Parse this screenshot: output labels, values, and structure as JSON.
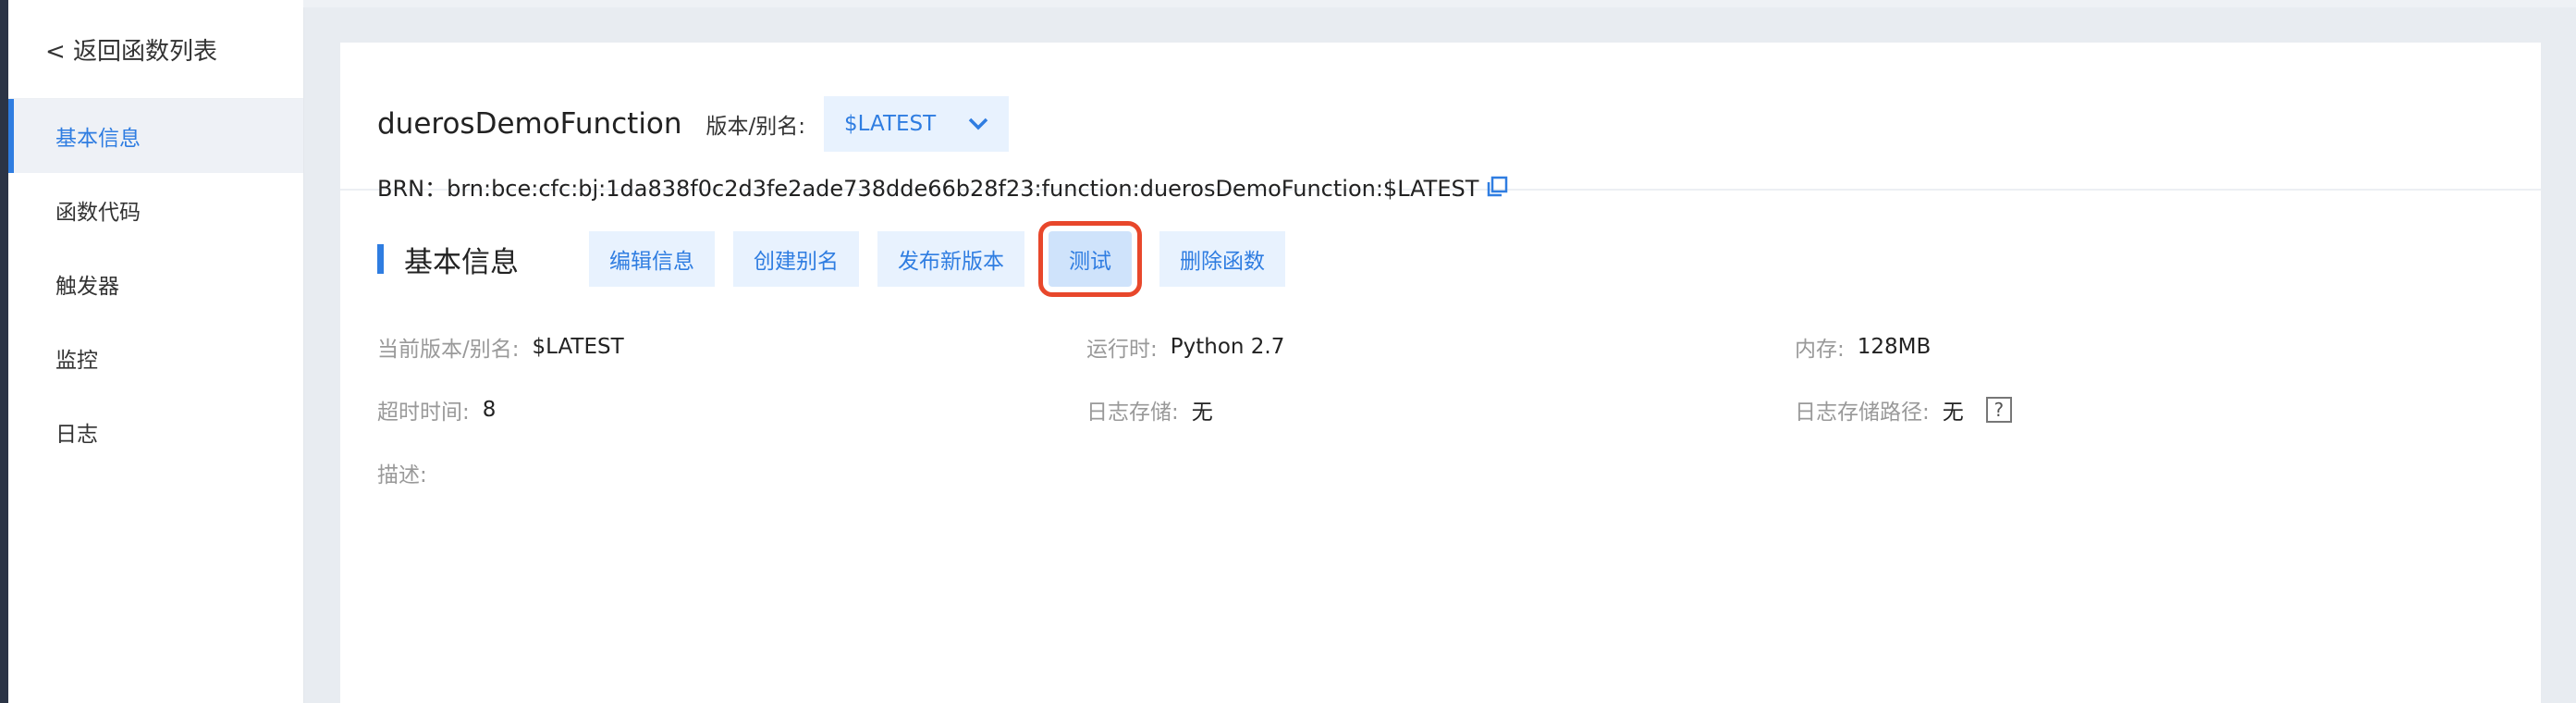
{
  "sidebar": {
    "back": "< 返回函数列表",
    "items": [
      {
        "label": "基本信息"
      },
      {
        "label": "函数代码"
      },
      {
        "label": "触发器"
      },
      {
        "label": "监控"
      },
      {
        "label": "日志"
      }
    ]
  },
  "header": {
    "function_name": "duerosDemoFunction",
    "version_label": "版本/别名:",
    "version_value": "$LATEST",
    "brn": "BRN：brn:bce:cfc:bj:1da838f0c2d3fe2ade738dde66b28f23:function:duerosDemoFunction:$LATEST"
  },
  "section": {
    "title": "基本信息",
    "buttons": [
      "编辑信息",
      "创建别名",
      "发布新版本",
      "测试",
      "删除函数"
    ]
  },
  "props": {
    "current_version": {
      "key": "当前版本/别名:",
      "value": "$LATEST"
    },
    "runtime": {
      "key": "运行时:",
      "value": "Python 2.7"
    },
    "memory": {
      "key": "内存:",
      "value": "128MB"
    },
    "timeout": {
      "key": "超时时间:",
      "value": "8"
    },
    "log_storage": {
      "key": "日志存储:",
      "value": "无"
    },
    "log_path": {
      "key": "日志存储路径:",
      "value": "无",
      "help": "?"
    },
    "description": {
      "key": "描述:"
    }
  },
  "colors": {
    "accent": "#2f7de1",
    "highlight": "#e8472b"
  },
  "icons": {
    "copy": "copy-icon",
    "dropdown": "chevron-down-icon",
    "help": "help-icon"
  }
}
